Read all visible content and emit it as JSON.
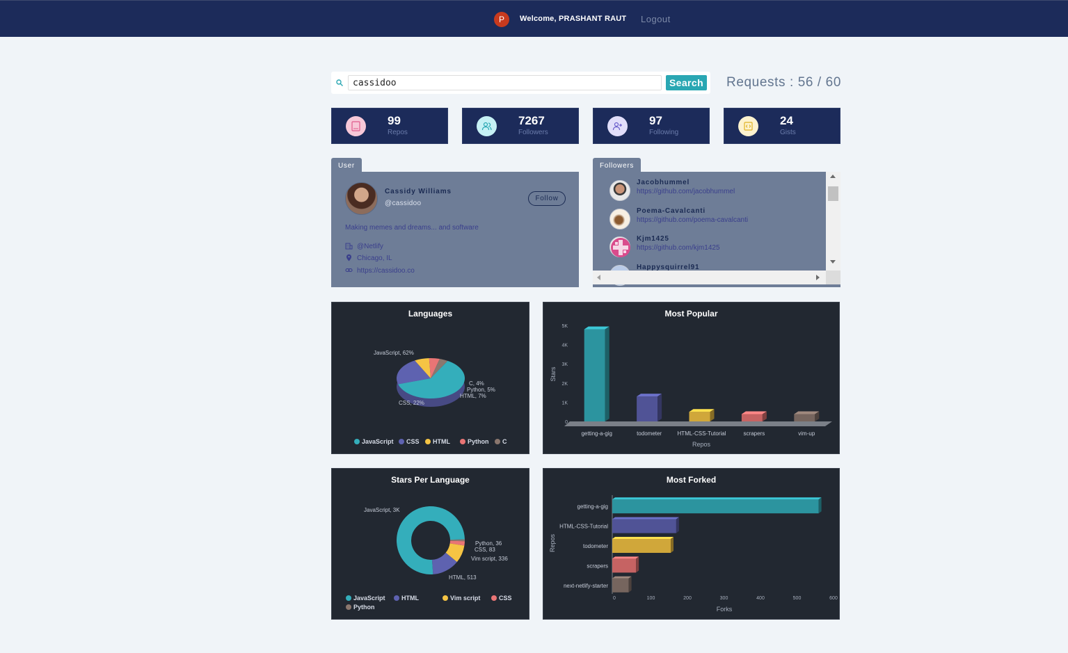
{
  "header": {
    "avatar_letter": "P",
    "welcome_prefix": "Welcome,",
    "username": "PRASHANT RAUT",
    "logout_label": "Logout"
  },
  "search": {
    "value": "cassidoo",
    "button_label": "Search",
    "requests_label": "Requests : 56 / 60"
  },
  "stats": [
    {
      "value": "99",
      "label": "Repos",
      "icon": "book-icon",
      "color": "#f4a9c2"
    },
    {
      "value": "7267",
      "label": "Followers",
      "icon": "users-icon",
      "color": "#9fe6ef"
    },
    {
      "value": "97",
      "label": "Following",
      "icon": "user-plus-icon",
      "color": "#c9c3f2"
    },
    {
      "value": "24",
      "label": "Gists",
      "icon": "code-icon",
      "color": "#fbe8ab"
    }
  ],
  "user": {
    "tab_label": "User",
    "name": "Cassidy Williams",
    "handle": "@cassidoo",
    "follow_label": "Follow",
    "bio": "Making memes and dreams... and software",
    "company": "@Netlify",
    "location": "Chicago, IL",
    "blog": "https://cassidoo.co"
  },
  "followers": {
    "tab_label": "Followers",
    "items": [
      {
        "name": "Jacobhummel",
        "url": "https://github.com/jacobhummel"
      },
      {
        "name": "Poema-Cavalcanti",
        "url": "https://github.com/poema-cavalcanti"
      },
      {
        "name": "Kjm1425",
        "url": "https://github.com/kjm1425"
      },
      {
        "name": "Happysquirrel91",
        "url": ""
      }
    ]
  },
  "colors": {
    "teal": "#34aebb",
    "indigo": "#5e62b0",
    "yellow": "#f5c444",
    "red": "#e97575",
    "brown": "#8b776e"
  },
  "chart_data": [
    {
      "type": "pie",
      "title": "Languages",
      "categories": [
        "JavaScript",
        "CSS",
        "HTML",
        "Python",
        "C"
      ],
      "values": [
        62,
        22,
        7,
        5,
        4
      ],
      "labels": [
        "JavaScript, 62%",
        "CSS, 22%",
        "HTML, 7%",
        "Python, 5%",
        "C, 4%"
      ],
      "legend": "bottom"
    },
    {
      "type": "bar",
      "title": "Most Popular",
      "categories": [
        "getting-a-gig",
        "todometer",
        "HTML-CSS-Tutorial",
        "scrapers",
        "vim-up"
      ],
      "values": [
        4800,
        1300,
        500,
        380,
        380
      ],
      "xlabel": "Repos",
      "ylabel": "Stars",
      "ylim": [
        0,
        5000
      ],
      "yticks": [
        "0",
        "1K",
        "2K",
        "3K",
        "4K",
        "5K"
      ]
    },
    {
      "type": "pie",
      "title": "Stars Per Language",
      "categories": [
        "JavaScript",
        "HTML",
        "Vim script",
        "CSS",
        "Python"
      ],
      "values": [
        3000,
        513,
        336,
        83,
        36
      ],
      "labels": [
        "JavaScript, 3K",
        "HTML, 513",
        "Vim script, 336",
        "CSS, 83",
        "Python, 36"
      ],
      "legend": "bottom"
    },
    {
      "type": "bar",
      "title": "Most Forked",
      "categories": [
        "getting-a-gig",
        "HTML-CSS-Tutorial",
        "todometer",
        "scrapers",
        "next-netlify-starter"
      ],
      "values": [
        565,
        175,
        160,
        65,
        45
      ],
      "xlabel": "Forks",
      "ylabel": "Repos",
      "xlim": [
        0,
        600
      ],
      "xticks": [
        "0",
        "100",
        "200",
        "300",
        "400",
        "500",
        "600"
      ]
    }
  ]
}
